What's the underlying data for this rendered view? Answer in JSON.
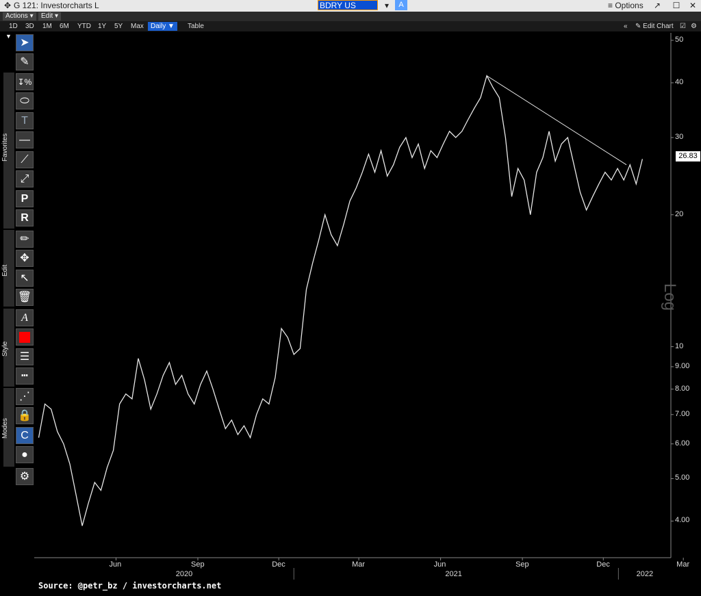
{
  "window": {
    "title": "G 121: Investorcharts L",
    "ticker": "BDRY US Equity",
    "ticker_dropdown_icon": "chevron-down-icon",
    "a_button": "A",
    "options": "Options"
  },
  "menubar": {
    "actions": "Actions ▾",
    "edit": "Edit ▾"
  },
  "ranges": [
    "1D",
    "3D",
    "1M",
    "6M",
    "YTD",
    "1Y",
    "5Y",
    "Max"
  ],
  "interval": "Daily ▼",
  "table": "Table",
  "edit_chart": "Edit Chart",
  "toolbar_groups": {
    "favorites": "Favorites",
    "edit": "Edit",
    "style": "Style",
    "modes": "Modes"
  },
  "source": "Source: @petr_bz / investorcharts.net",
  "scale_label": "Log",
  "last_value": "26.83",
  "y_ticks": [
    "50",
    "40",
    "30",
    "20",
    "10",
    "9.00",
    "8.00",
    "7.00",
    "6.00",
    "5.00",
    "4.00"
  ],
  "x_months": [
    "Jun",
    "Sep",
    "Dec",
    "Mar",
    "Jun",
    "Sep",
    "Dec",
    "Mar"
  ],
  "x_years": [
    "2020",
    "2021",
    "2022"
  ],
  "chart_data": {
    "type": "line",
    "series": [
      {
        "name": "BDRY US Equity",
        "points": [
          [
            "2020-03-20",
            6.2
          ],
          [
            "2020-03-27",
            7.4
          ],
          [
            "2020-04-03",
            7.2
          ],
          [
            "2020-04-10",
            6.4
          ],
          [
            "2020-04-17",
            6.0
          ],
          [
            "2020-04-24",
            5.4
          ],
          [
            "2020-05-01",
            4.6
          ],
          [
            "2020-05-08",
            3.9
          ],
          [
            "2020-05-15",
            4.4
          ],
          [
            "2020-05-22",
            4.9
          ],
          [
            "2020-05-29",
            4.7
          ],
          [
            "2020-06-05",
            5.3
          ],
          [
            "2020-06-12",
            5.8
          ],
          [
            "2020-06-19",
            7.4
          ],
          [
            "2020-06-26",
            7.8
          ],
          [
            "2020-07-03",
            7.6
          ],
          [
            "2020-07-10",
            9.4
          ],
          [
            "2020-07-17",
            8.4
          ],
          [
            "2020-07-24",
            7.2
          ],
          [
            "2020-07-31",
            7.8
          ],
          [
            "2020-08-07",
            8.6
          ],
          [
            "2020-08-14",
            9.2
          ],
          [
            "2020-08-21",
            8.2
          ],
          [
            "2020-08-28",
            8.6
          ],
          [
            "2020-09-04",
            7.8
          ],
          [
            "2020-09-11",
            7.4
          ],
          [
            "2020-09-18",
            8.2
          ],
          [
            "2020-09-25",
            8.8
          ],
          [
            "2020-10-02",
            8.0
          ],
          [
            "2020-10-09",
            7.2
          ],
          [
            "2020-10-16",
            6.5
          ],
          [
            "2020-10-23",
            6.8
          ],
          [
            "2020-10-30",
            6.3
          ],
          [
            "2020-11-06",
            6.6
          ],
          [
            "2020-11-13",
            6.2
          ],
          [
            "2020-11-20",
            7.0
          ],
          [
            "2020-11-27",
            7.6
          ],
          [
            "2020-12-04",
            7.4
          ],
          [
            "2020-12-11",
            8.5
          ],
          [
            "2020-12-18",
            11.0
          ],
          [
            "2020-12-25",
            10.5
          ],
          [
            "2021-01-01",
            9.6
          ],
          [
            "2021-01-08",
            9.9
          ],
          [
            "2021-01-15",
            13.5
          ],
          [
            "2021-01-22",
            15.5
          ],
          [
            "2021-01-29",
            17.5
          ],
          [
            "2021-02-05",
            20.0
          ],
          [
            "2021-02-12",
            18.0
          ],
          [
            "2021-02-19",
            17.0
          ],
          [
            "2021-02-26",
            19.0
          ],
          [
            "2021-03-05",
            21.5
          ],
          [
            "2021-03-12",
            23.0
          ],
          [
            "2021-03-19",
            25.0
          ],
          [
            "2021-03-26",
            27.5
          ],
          [
            "2021-04-02",
            25.0
          ],
          [
            "2021-04-09",
            28.0
          ],
          [
            "2021-04-16",
            24.5
          ],
          [
            "2021-04-23",
            26.0
          ],
          [
            "2021-04-30",
            28.5
          ],
          [
            "2021-05-07",
            30.0
          ],
          [
            "2021-05-14",
            27.0
          ],
          [
            "2021-05-21",
            29.0
          ],
          [
            "2021-05-28",
            25.5
          ],
          [
            "2021-06-04",
            28.0
          ],
          [
            "2021-06-11",
            27.0
          ],
          [
            "2021-06-18",
            29.0
          ],
          [
            "2021-06-25",
            31.0
          ],
          [
            "2021-07-02",
            30.0
          ],
          [
            "2021-07-09",
            31.0
          ],
          [
            "2021-07-16",
            33.0
          ],
          [
            "2021-07-23",
            35.0
          ],
          [
            "2021-07-30",
            37.0
          ],
          [
            "2021-08-06",
            41.5
          ],
          [
            "2021-08-13",
            39.0
          ],
          [
            "2021-08-20",
            37.0
          ],
          [
            "2021-08-27",
            30.0
          ],
          [
            "2021-09-03",
            22.0
          ],
          [
            "2021-09-10",
            25.5
          ],
          [
            "2021-09-17",
            24.0
          ],
          [
            "2021-09-24",
            20.0
          ],
          [
            "2021-10-01",
            25.0
          ],
          [
            "2021-10-08",
            27.0
          ],
          [
            "2021-10-15",
            31.0
          ],
          [
            "2021-10-22",
            26.5
          ],
          [
            "2021-10-29",
            29.0
          ],
          [
            "2021-11-05",
            30.0
          ],
          [
            "2021-11-12",
            26.0
          ],
          [
            "2021-11-19",
            22.5
          ],
          [
            "2021-11-26",
            20.5
          ],
          [
            "2021-12-03",
            22.0
          ],
          [
            "2021-12-10",
            23.5
          ],
          [
            "2021-12-17",
            25.0
          ],
          [
            "2021-12-24",
            24.0
          ],
          [
            "2021-12-31",
            25.5
          ],
          [
            "2022-01-07",
            24.0
          ],
          [
            "2022-01-14",
            26.0
          ],
          [
            "2022-01-21",
            23.5
          ],
          [
            "2022-01-28",
            26.8
          ]
        ]
      }
    ],
    "trendline": [
      [
        "2021-08-06",
        41.5
      ],
      [
        "2022-01-10",
        26.0
      ]
    ],
    "y_scale": "log",
    "ylim": [
      3.3,
      52
    ],
    "xlim": [
      "2020-03-15",
      "2022-03-01"
    ],
    "grid": false
  }
}
